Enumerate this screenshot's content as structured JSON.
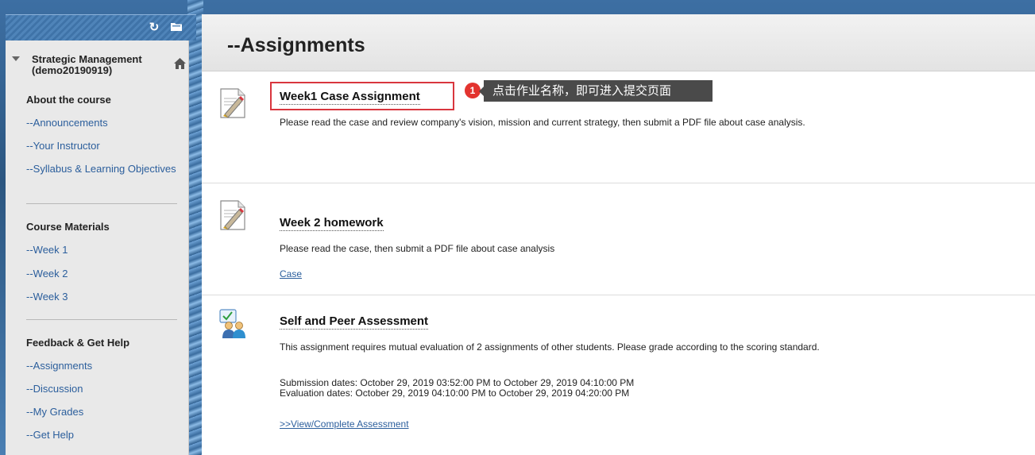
{
  "sidebar": {
    "refresh_icon": "refresh-icon",
    "folder_icon": "folder-icon",
    "course_title": "Strategic Management (demo20190919)",
    "sections": [
      {
        "title": "About the course",
        "links": [
          "--Announcements",
          "--Your Instructor",
          "--Syllabus & Learning Objectives"
        ]
      },
      {
        "title": "Course Materials",
        "links": [
          "--Week 1",
          "--Week 2",
          "--Week 3"
        ]
      },
      {
        "title": "Feedback & Get Help",
        "links": [
          "--Assignments",
          "--Discussion",
          "--My Grades",
          "--Get Help"
        ]
      }
    ]
  },
  "main": {
    "title": "--Assignments",
    "items": [
      {
        "title": "Week1 Case Assignment",
        "icon": "assignment-icon",
        "description": "Please read the case and review company's vision, mission and current strategy, then submit a PDF file about case analysis."
      },
      {
        "title": "Week 2 homework",
        "icon": "assignment-icon",
        "description": "Please read the case, then submit a PDF file about case analysis",
        "link": "Case"
      },
      {
        "title": "Self and Peer Assessment",
        "icon": "peer-assessment-icon",
        "description": "This assignment requires mutual evaluation of 2 assignments of other students. Please grade according to the scoring standard.",
        "submission_dates": "Submission dates: October 29, 2019 03:52:00 PM to October 29, 2019 04:10:00 PM",
        "evaluation_dates": "Evaluation dates: October 29, 2019 04:10:00 PM to October 29, 2019 04:20:00 PM",
        "link": ">>View/Complete Assessment"
      }
    ]
  },
  "callout": {
    "badge": "1",
    "text": "点击作业名称，即可进入提交页面"
  },
  "colors": {
    "link": "#2b5e9c",
    "highlight": "#d9363e",
    "badge": "#e3342f",
    "tooltip": "#4a4a4a"
  }
}
